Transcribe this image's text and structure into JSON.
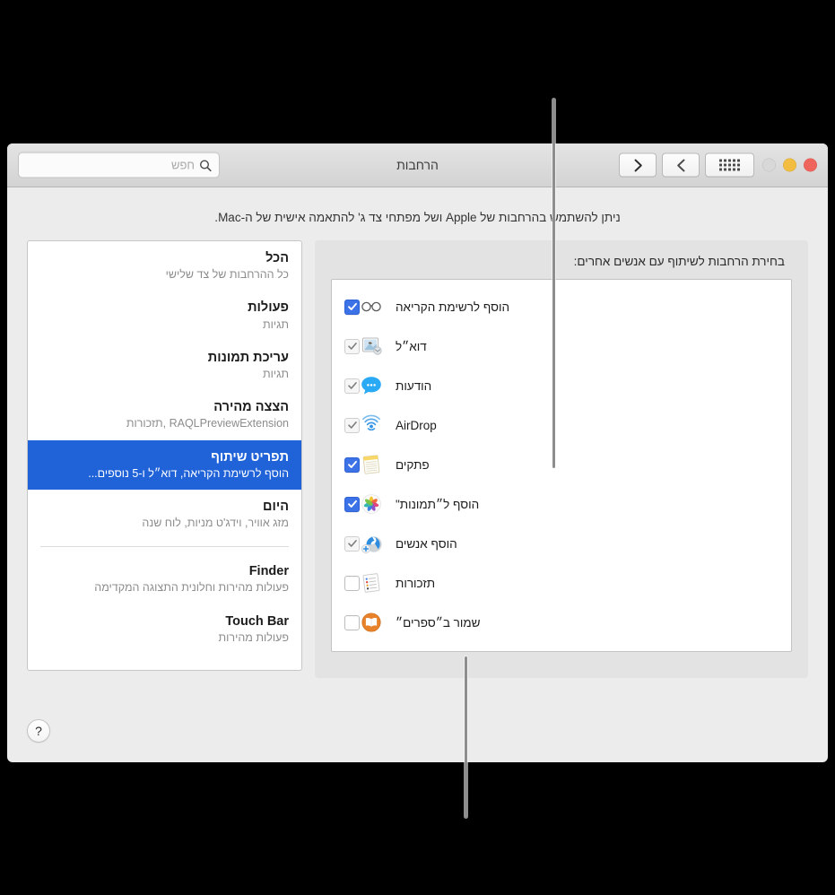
{
  "window": {
    "title": "הרחבות",
    "traffic_lights": [
      "close",
      "minimize",
      "zoom"
    ],
    "toolbar": {
      "show_all_label": "הצג הכל",
      "back_label": "אחורה",
      "forward_label": "קדימה"
    },
    "search": {
      "placeholder": "חפש",
      "value": ""
    },
    "description": "ניתן להשתמש בהרחבות של Apple ושל מפתחי צד ג' להתאמה אישית של ה-Mac.",
    "help_label": "?"
  },
  "sidebar": {
    "items": [
      {
        "title": "הכל",
        "subtitle": "כל ההרחבות של צד שלישי",
        "selected": false,
        "separator_after": false
      },
      {
        "title": "פעולות",
        "subtitle": "תגיות",
        "selected": false,
        "separator_after": false
      },
      {
        "title": "עריכת תמונות",
        "subtitle": "תגיות",
        "selected": false,
        "separator_after": false
      },
      {
        "title": "הצצה מהירה",
        "subtitle": "RAQLPreviewExtension ,תזכורות",
        "selected": false,
        "separator_after": false
      },
      {
        "title": "תפריט שיתוף",
        "subtitle": "הוסף לרשימת הקריאה, דוא״ל ו-5 נוספים...",
        "selected": true,
        "separator_after": false
      },
      {
        "title": "היום",
        "subtitle": "מזג אוויר, וידג'ט מניות, לוח שנה",
        "selected": false,
        "separator_after": true
      },
      {
        "title": "Finder",
        "subtitle": "פעולות מהירות וחלונית התצוגה המקדימה",
        "selected": false,
        "separator_after": false
      },
      {
        "title": "Touch Bar",
        "subtitle": "פעולות מהירות",
        "selected": false,
        "separator_after": false
      }
    ]
  },
  "main": {
    "label": "בחירת הרחבות לשיתוף עם אנשים אחרים:",
    "extensions": [
      {
        "label": "הוסף לרשימת הקריאה",
        "icon": "reading-list-glasses-icon",
        "state": "checked-enabled"
      },
      {
        "label": "דוא״ל",
        "icon": "mail-icon",
        "state": "checked-disabled"
      },
      {
        "label": "הודעות",
        "icon": "messages-icon",
        "state": "checked-disabled"
      },
      {
        "label": "AirDrop",
        "icon": "airdrop-icon",
        "state": "checked-disabled"
      },
      {
        "label": "פתקים",
        "icon": "notes-icon",
        "state": "checked-enabled"
      },
      {
        "label": "הוסף ל״תמונות\"",
        "icon": "photos-icon",
        "state": "checked-enabled"
      },
      {
        "label": "הוסף אנשים",
        "icon": "add-people-icon",
        "state": "checked-disabled"
      },
      {
        "label": "תזכורות",
        "icon": "reminders-icon",
        "state": "unchecked"
      },
      {
        "label": "שמור ב״ספרים״",
        "icon": "books-icon",
        "state": "unchecked"
      }
    ]
  },
  "colors": {
    "selection_blue": "#2063d8",
    "checkbox_blue": "#3b72e8",
    "window_background": "#ececec",
    "pane_background": "#e3e3e3",
    "callout_line": "#8e8e8e"
  },
  "callouts": [
    {
      "name": "callout-top",
      "points_to": "sidebar-item-share-menu"
    },
    {
      "name": "callout-bottom",
      "points_to": "extension-checkbox-books"
    }
  ]
}
